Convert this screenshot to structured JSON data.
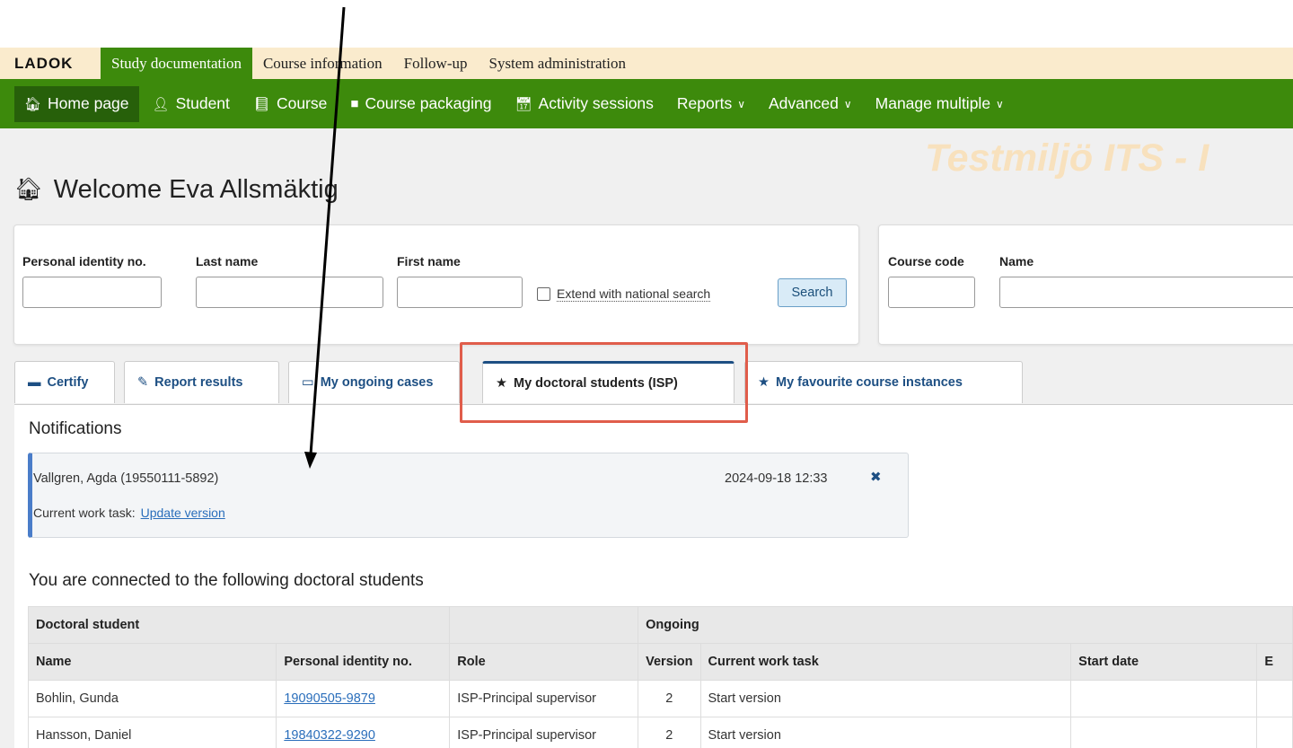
{
  "topbar": {
    "logo": "LADOK",
    "tabs": [
      "Study documentation",
      "Course information",
      "Follow-up",
      "System administration"
    ]
  },
  "nav": {
    "home": "Home page",
    "student": "Student",
    "course": "Course",
    "course_packaging": "Course packaging",
    "activity_sessions": "Activity sessions",
    "reports": "Reports",
    "advanced": "Advanced",
    "manage_multiple": "Manage multiple"
  },
  "watermark": "Testmiljö ITS - I",
  "welcome": "Welcome Eva Allsmäktig",
  "student_search": {
    "pin_label": "Personal identity no.",
    "last_name_label": "Last name",
    "first_name_label": "First name",
    "extend_label": "Extend with national search",
    "search_button": "Search"
  },
  "course_search": {
    "code_label": "Course code",
    "name_label": "Name"
  },
  "tabs": {
    "certify": "Certify",
    "report_results": "Report results",
    "ongoing_cases": "My ongoing cases",
    "doctoral_students": "My doctoral students (ISP)",
    "favourite_courses": "My favourite course instances"
  },
  "notifications": {
    "title": "Notifications",
    "item": {
      "name": "Vallgren, Agda (19550111-5892)",
      "date": "2024-09-18 12:33",
      "task_label": "Current work task:",
      "task_link": "Update version"
    }
  },
  "connected": {
    "title": "You are connected to the following doctoral students",
    "group_headers": {
      "doctoral_student": "Doctoral student",
      "ongoing": "Ongoing"
    },
    "columns": [
      "Name",
      "Personal identity no.",
      "Role",
      "Version",
      "Current work task",
      "Start date",
      "E"
    ],
    "rows": [
      {
        "name": "Bohlin, Gunda",
        "pin": "19090505-9879",
        "role": "ISP-Principal supervisor",
        "version": "2",
        "task": "Start version"
      },
      {
        "name": "Hansson, Daniel",
        "pin": "19840322-9290",
        "role": "ISP-Principal supervisor",
        "version": "2",
        "task": "Start version"
      }
    ]
  },
  "colors": {
    "green": "#3d8a0c",
    "green_dark": "#27600a",
    "highlight": "#e05d4b",
    "link": "#2a6ebb"
  }
}
